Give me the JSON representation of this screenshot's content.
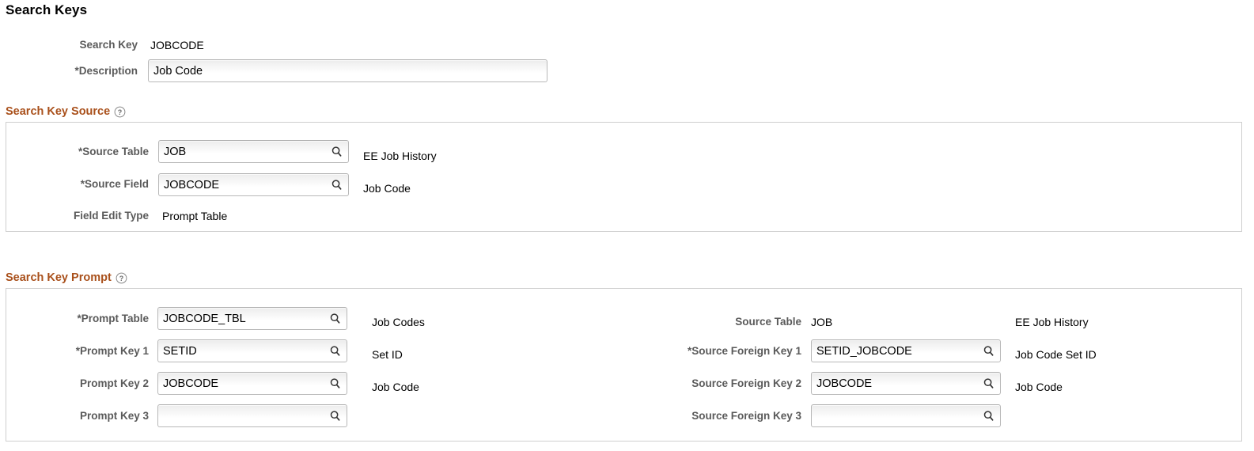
{
  "page": {
    "title": "Search Keys"
  },
  "top_fields": [
    {
      "label": "Search Key",
      "required": false,
      "value": "JOBCODE"
    }
  ],
  "description_field": {
    "label": "Description",
    "required": true,
    "value": "Job Code"
  },
  "search_key_source": {
    "header": "Search Key Source",
    "help_icon": "help-circle-icon",
    "rows": [
      {
        "label": "Source Table",
        "required": true,
        "type": "lookup",
        "value": "JOB",
        "lookup_icon": "magnifier-icon",
        "description": "EE Job History"
      },
      {
        "label": "Source Field",
        "required": true,
        "type": "lookup",
        "value": "JOBCODE",
        "lookup_icon": "magnifier-icon",
        "description": "Job Code"
      },
      {
        "label": "Field Edit Type",
        "required": false,
        "type": "text",
        "value": "Prompt Table",
        "description": ""
      }
    ]
  },
  "search_key_prompt": {
    "header": "Search Key Prompt",
    "help_icon": "help-circle-icon",
    "left_rows": [
      {
        "label": "Prompt Table",
        "required": true,
        "type": "lookup",
        "value": "JOBCODE_TBL",
        "lookup_icon": "magnifier-icon",
        "description": "Job Codes"
      },
      {
        "label": "Prompt Key 1",
        "required": true,
        "type": "lookup",
        "value": "SETID",
        "lookup_icon": "magnifier-icon",
        "description": "Set ID"
      },
      {
        "label": "Prompt Key 2",
        "required": false,
        "type": "lookup",
        "value": "JOBCODE",
        "lookup_icon": "magnifier-icon",
        "description": "Job Code"
      },
      {
        "label": "Prompt Key 3",
        "required": false,
        "type": "lookup",
        "value": "",
        "lookup_icon": "magnifier-icon",
        "description": ""
      }
    ],
    "right_rows": [
      {
        "label": "Source Table",
        "required": false,
        "type": "text",
        "value": "JOB",
        "description": "EE Job History"
      },
      {
        "label": "Source Foreign Key 1",
        "required": true,
        "type": "lookup",
        "value": "SETID_JOBCODE",
        "lookup_icon": "magnifier-icon",
        "description": "Job Code Set ID"
      },
      {
        "label": "Source Foreign Key 2",
        "required": false,
        "type": "lookup",
        "value": "JOBCODE",
        "lookup_icon": "magnifier-icon",
        "description": "Job Code"
      },
      {
        "label": "Source Foreign Key 3",
        "required": false,
        "type": "lookup",
        "value": "",
        "lookup_icon": "magnifier-icon",
        "description": ""
      }
    ]
  },
  "colors": {
    "group_header": "#a9501b",
    "label": "#5a5a5a",
    "border": "#cfcfcf",
    "input_border": "#b8b8b8"
  }
}
